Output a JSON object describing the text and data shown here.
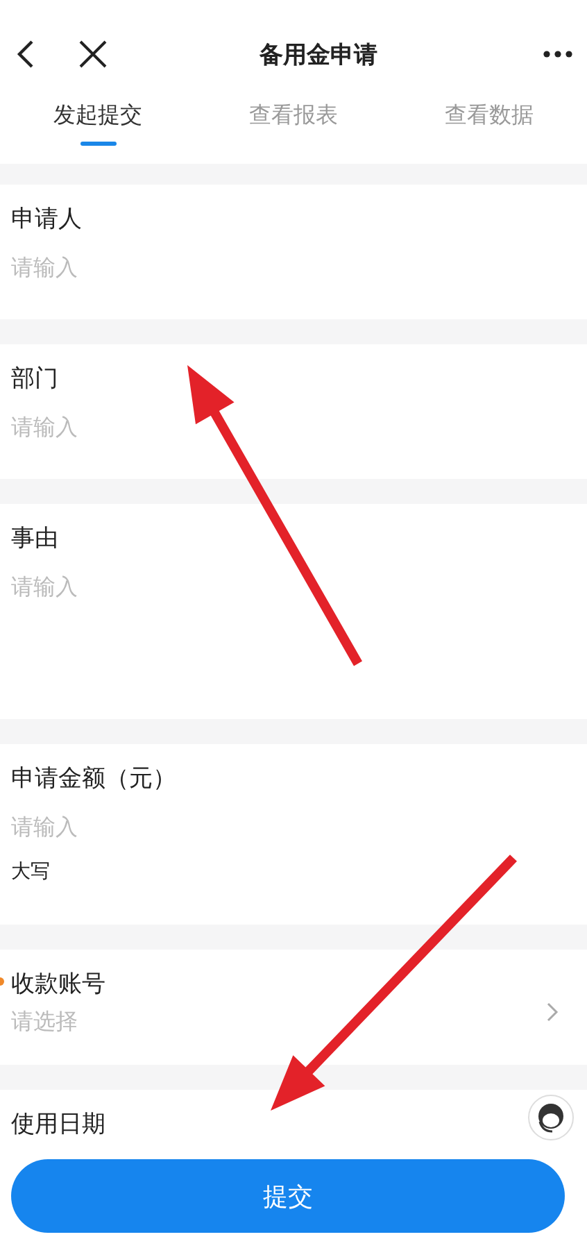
{
  "header": {
    "title": "备用金申请"
  },
  "tabs": [
    {
      "label": "发起提交",
      "selected": true
    },
    {
      "label": "查看报表",
      "selected": false
    },
    {
      "label": "查看数据",
      "selected": false
    }
  ],
  "fields": [
    {
      "kind": "input",
      "label": "申请人",
      "placeholder": "请输入",
      "required": false
    },
    {
      "kind": "input",
      "label": "部门",
      "placeholder": "请输入",
      "required": false
    },
    {
      "kind": "textarea",
      "label": "事由",
      "placeholder": "请输入",
      "required": false
    },
    {
      "kind": "amount",
      "label": "申请金额（元）",
      "placeholder": "请输入",
      "note": "大写",
      "required": false
    },
    {
      "kind": "select",
      "label": "收款账号",
      "placeholder": "请选择",
      "required": true
    },
    {
      "kind": "date",
      "label": "使用日期",
      "required": false
    }
  ],
  "submit": "提交"
}
